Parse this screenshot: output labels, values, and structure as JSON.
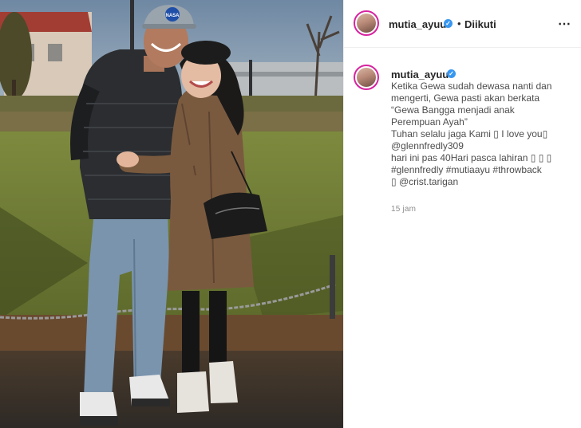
{
  "post": {
    "author": {
      "username": "mutia_ayuu",
      "verified": true
    },
    "header": {
      "separator": "•",
      "follow_status": "Diikuti",
      "more_icon": "more-options-icon"
    },
    "photo": {
      "cap_logo_text": "NASA"
    },
    "caption": {
      "lines": [
        "Ketika Gewa sudah dewasa nanti dan",
        "mengerti, Gewa pasti akan berkata",
        "“Gewa Bangga menjadi anak",
        "Perempuan Ayah”",
        "Tuhan selalu jaga Kami ▯ I love you▯",
        "@glennfredly309",
        "hari ini pas 40Hari pasca lahiran ▯ ▯ ▯",
        "#glennfredly #mutiaayu #throwback",
        "▯ @crist.tarigan"
      ]
    },
    "timestamp": "15 jam"
  },
  "colors": {
    "verified_blue": "#3897f0",
    "text_dark": "#262626",
    "text_muted": "#8e8e8e",
    "avatar_ring": "#d6249f"
  }
}
